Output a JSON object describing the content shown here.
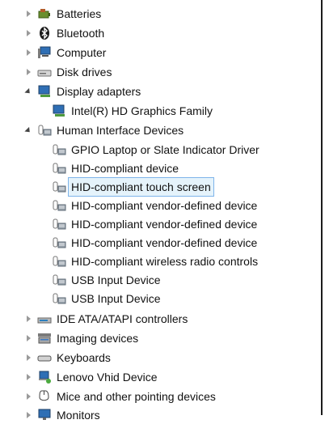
{
  "tree": {
    "items": [
      {
        "label": "Batteries",
        "icon": "battery-icon",
        "expander": "collapsed"
      },
      {
        "label": "Bluetooth",
        "icon": "bluetooth-icon",
        "expander": "collapsed"
      },
      {
        "label": "Computer",
        "icon": "computer-icon",
        "expander": "collapsed"
      },
      {
        "label": "Disk drives",
        "icon": "disk-drive-icon",
        "expander": "collapsed"
      },
      {
        "label": "Display adapters",
        "icon": "display-adapter-icon",
        "expander": "expanded"
      },
      {
        "label": "Intel(R) HD Graphics Family",
        "icon": "display-adapter-icon"
      },
      {
        "label": "Human Interface Devices",
        "icon": "hid-icon",
        "expander": "expanded"
      },
      {
        "label": "GPIO Laptop or Slate Indicator Driver",
        "icon": "hid-icon"
      },
      {
        "label": "HID-compliant device",
        "icon": "hid-icon"
      },
      {
        "label": "HID-compliant touch screen",
        "icon": "hid-icon",
        "selected": true
      },
      {
        "label": "HID-compliant vendor-defined device",
        "icon": "hid-icon"
      },
      {
        "label": "HID-compliant vendor-defined device",
        "icon": "hid-icon"
      },
      {
        "label": "HID-compliant vendor-defined device",
        "icon": "hid-icon"
      },
      {
        "label": "HID-compliant wireless radio controls",
        "icon": "hid-icon"
      },
      {
        "label": "USB Input Device",
        "icon": "hid-icon"
      },
      {
        "label": "USB Input Device",
        "icon": "hid-icon"
      },
      {
        "label": "IDE ATA/ATAPI controllers",
        "icon": "ide-controller-icon",
        "expander": "collapsed"
      },
      {
        "label": "Imaging devices",
        "icon": "imaging-device-icon",
        "expander": "collapsed"
      },
      {
        "label": "Keyboards",
        "icon": "keyboard-icon",
        "expander": "collapsed"
      },
      {
        "label": "Lenovo Vhid Device",
        "icon": "lenovo-vhid-icon",
        "expander": "collapsed"
      },
      {
        "label": "Mice and other pointing devices",
        "icon": "mouse-icon",
        "expander": "collapsed"
      },
      {
        "label": "Monitors",
        "icon": "monitor-icon",
        "expander": "collapsed"
      }
    ]
  },
  "colors": {
    "selection_fill": "#e5f3fb",
    "selection_border": "#7eb4ea",
    "frame": "#1c1c1c"
  }
}
